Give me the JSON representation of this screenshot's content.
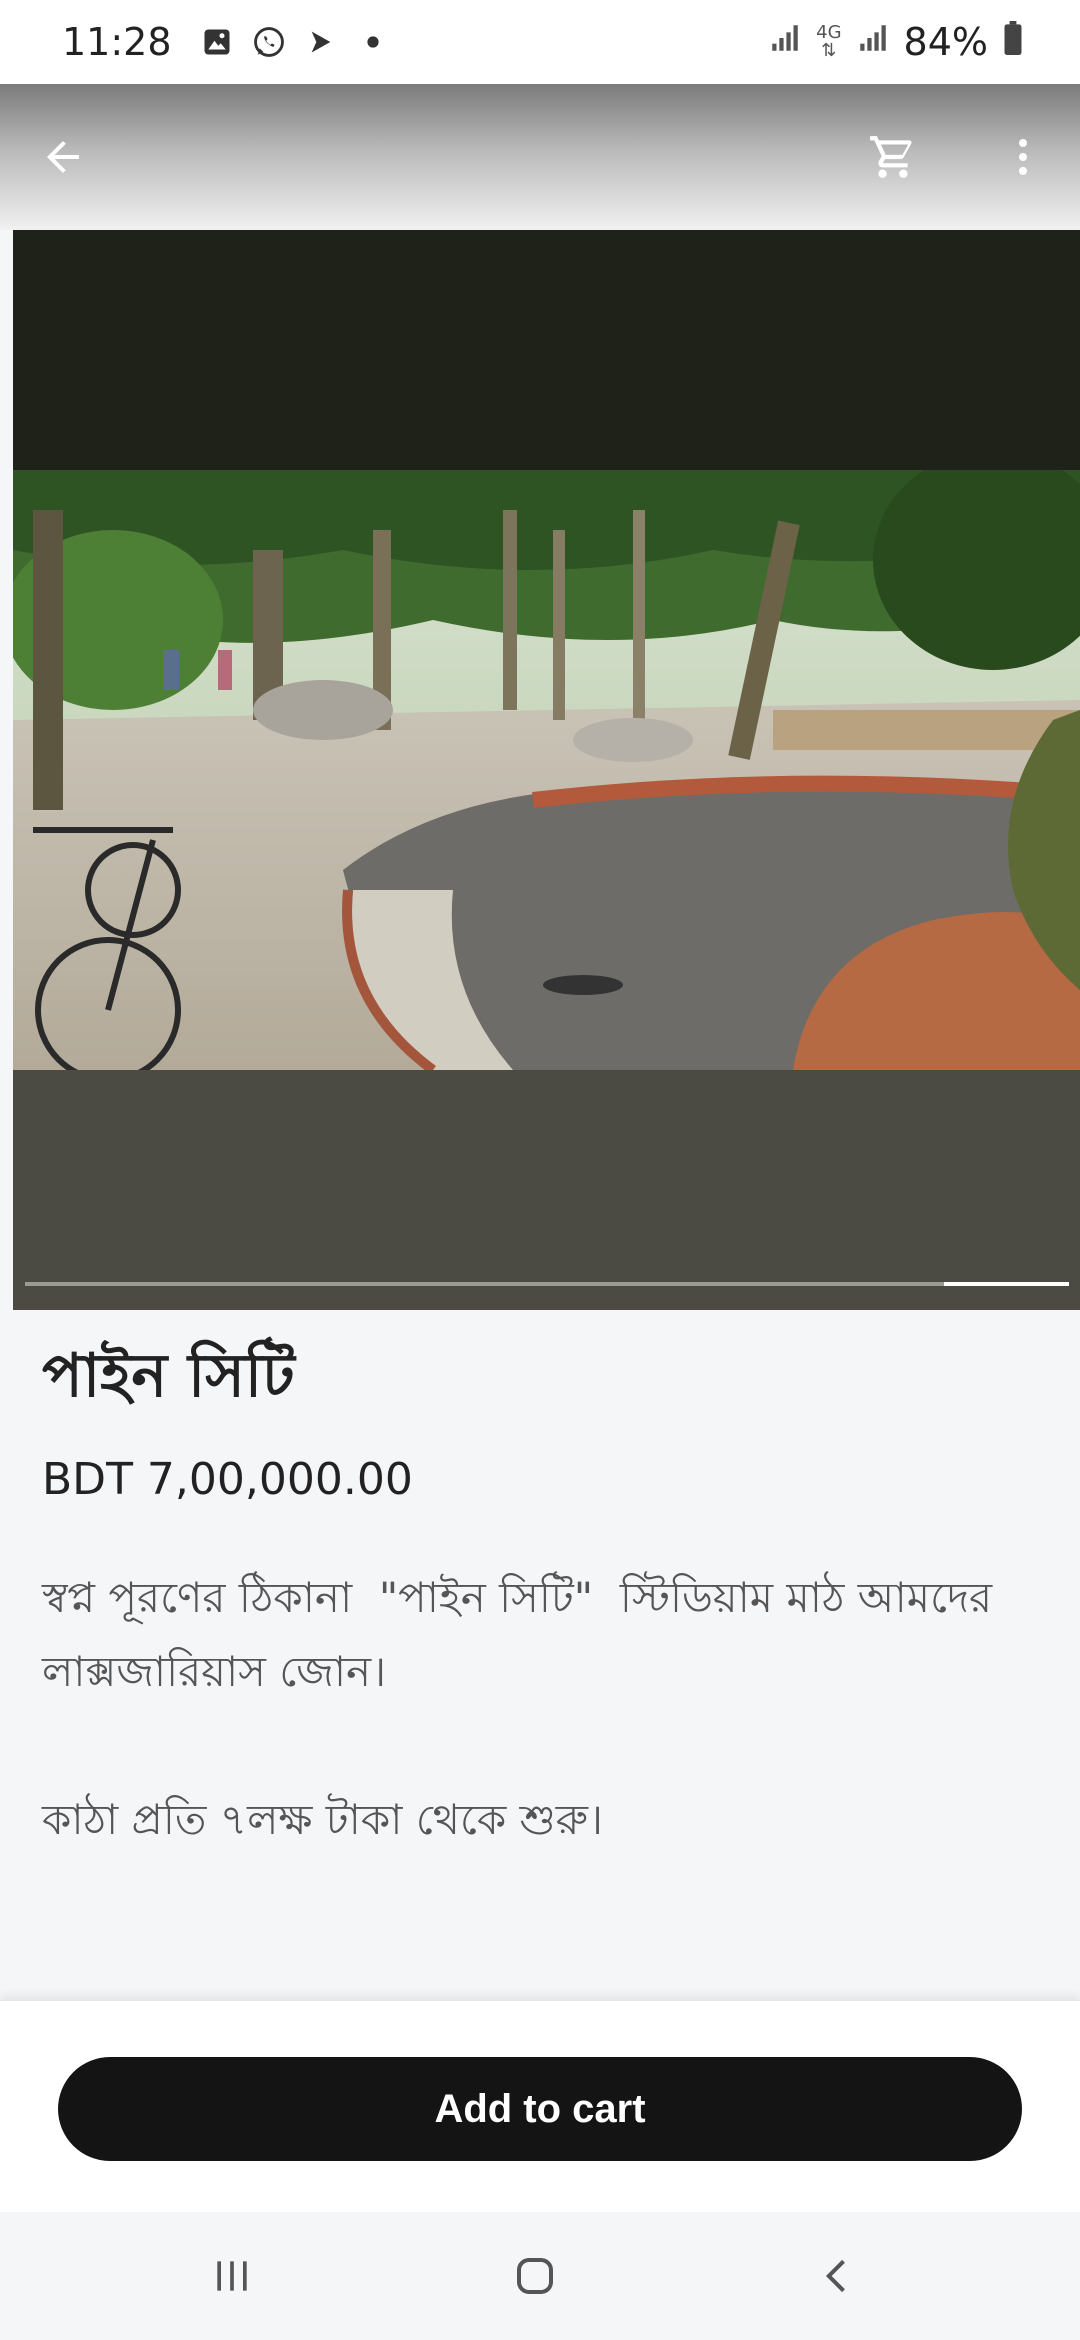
{
  "status_bar": {
    "time": "11:28",
    "left_icons": [
      "gallery-icon",
      "whatsapp-icon",
      "send-icon",
      "dot-icon"
    ],
    "network": "4G",
    "battery": "84%"
  },
  "app_bar": {
    "back_icon": "back-arrow-icon",
    "cart_icon": "cart-icon",
    "menu_icon": "more-vert-icon"
  },
  "product": {
    "image_progress_fraction": 0.12,
    "title": "পাইন সিটি",
    "price": "BDT 7,00,000.00",
    "description_line1": "স্বপ্ন পূরণের ঠিকানা  \"পাইন সিটি\"  স্টিডিয়াম মাঠ আমদের লাক্সজারিয়াস জোন।",
    "description_line2": "কাঠা প্রতি ৭লক্ষ টাকা থেকে শুরু।"
  },
  "cart": {
    "add_to_cart_label": "Add to cart"
  },
  "nav_bar": {
    "icons": [
      "recent-apps-icon",
      "home-icon",
      "back-icon"
    ]
  },
  "colors": {
    "button": "#141414",
    "page_background": "#f5f6f8"
  }
}
